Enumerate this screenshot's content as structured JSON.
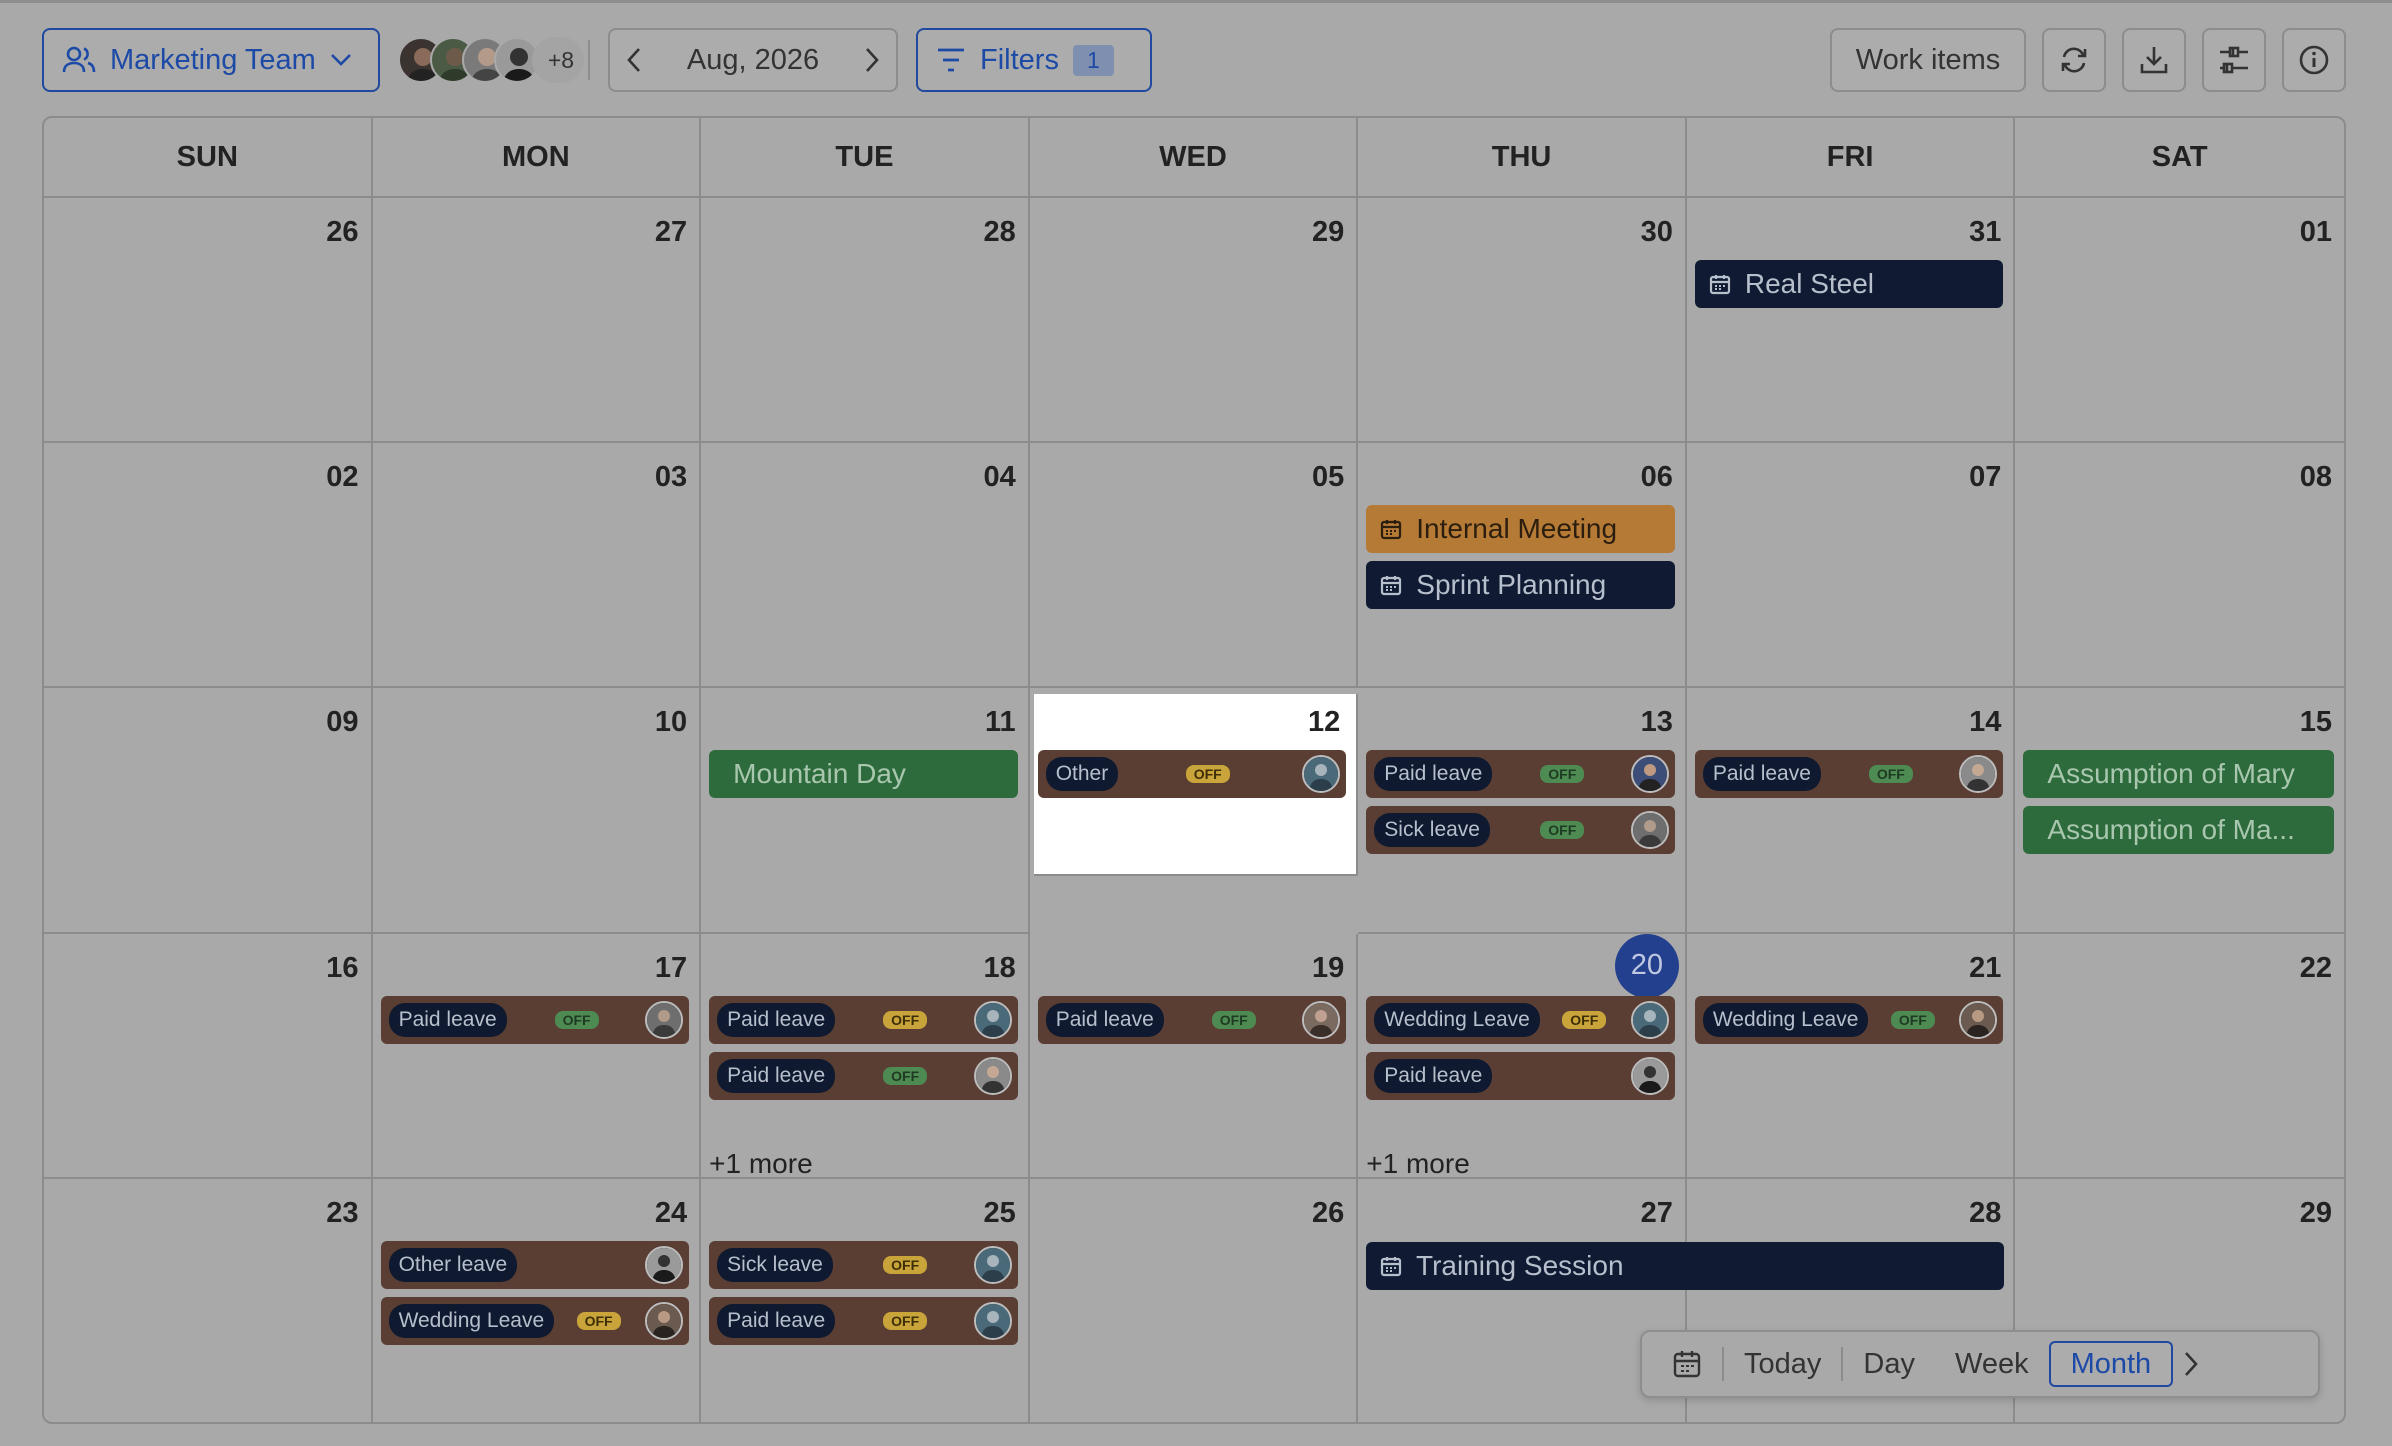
{
  "toolbar": {
    "team_label": "Marketing Team",
    "avatars_more": "+8",
    "date_label": "Aug, 2026",
    "filters_label": "Filters",
    "filters_count": "1",
    "work_items_label": "Work items"
  },
  "weekdays": [
    "SUN",
    "MON",
    "TUE",
    "WED",
    "THU",
    "FRI",
    "SAT"
  ],
  "days": [
    "26",
    "27",
    "28",
    "29",
    "30",
    "31",
    "01",
    "02",
    "03",
    "04",
    "05",
    "06",
    "07",
    "08",
    "09",
    "10",
    "11",
    "12",
    "13",
    "14",
    "15",
    "16",
    "17",
    "18",
    "19",
    "20",
    "21",
    "22",
    "23",
    "24",
    "25",
    "26",
    "27",
    "28",
    "29"
  ],
  "events": {
    "real_steel": "Real Steel",
    "internal_meeting": "Internal Meeting",
    "sprint_planning": "Sprint Planning",
    "mountain_day": "Mountain Day",
    "other": "Other",
    "paid_leave": "Paid leave",
    "sick_leave": "Sick leave",
    "assumption_1": "Assumption of Mary",
    "assumption_2": "Assumption of Ma...",
    "wedding_leave": "Wedding Leave",
    "other_leave": "Other leave",
    "training_session": "Training Session",
    "more_18": "+1 more",
    "more_20": "+1 more",
    "off": "OFF"
  },
  "viewbar": {
    "today": "Today",
    "day": "Day",
    "week": "Week",
    "month": "Month"
  },
  "colors": {
    "accent": "#1d4aa6",
    "meeting": "#101b33",
    "meeting_orange": "#b57a36",
    "holiday": "#2d6b3c",
    "leave": "#5a3e34",
    "today_circle": "#23408f"
  }
}
